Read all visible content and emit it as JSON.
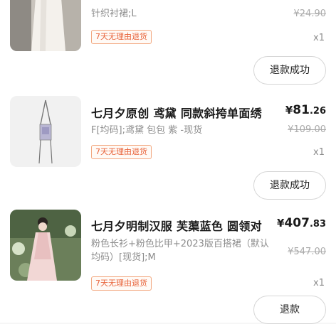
{
  "orders": [
    {
      "title": "",
      "spec": "针织衬裙;L",
      "price_symbol": "¥",
      "price_int": "",
      "price_dec": "",
      "original_price": "¥24.90",
      "quantity": "x1",
      "return_tag": "7天无理由退货",
      "action_label": "退款成功",
      "thumb_icon": "white-skirt-photo"
    },
    {
      "title": "七月夕原创 鸢黛 同款斜挎单面绣",
      "spec": "F[均码];鸢黛 包包 紫 -现货",
      "price_symbol": "¥",
      "price_int": "81",
      "price_dec": ".26",
      "original_price": "¥109.00",
      "quantity": "x1",
      "return_tag": "7天无理由退货",
      "action_label": "退款成功",
      "thumb_icon": "crossbody-bag-photo"
    },
    {
      "title": "七月夕明制汉服 芙蕖蓝色 圆领对",
      "spec": "粉色长衫+粉色比甲+2023版百搭裙（默认均码）[现货];M",
      "price_symbol": "¥",
      "price_int": "407",
      "price_dec": ".83",
      "original_price": "¥547.00",
      "quantity": "x1",
      "return_tag": "7天无理由退货",
      "action_label": "退款",
      "thumb_icon": "hanfu-model-photo"
    }
  ],
  "colors": {
    "tag_text": "#e8633a",
    "tag_border": "#f2a77f",
    "strikethrough": "#aaaaaa",
    "button_border": "#d6d6d6"
  }
}
